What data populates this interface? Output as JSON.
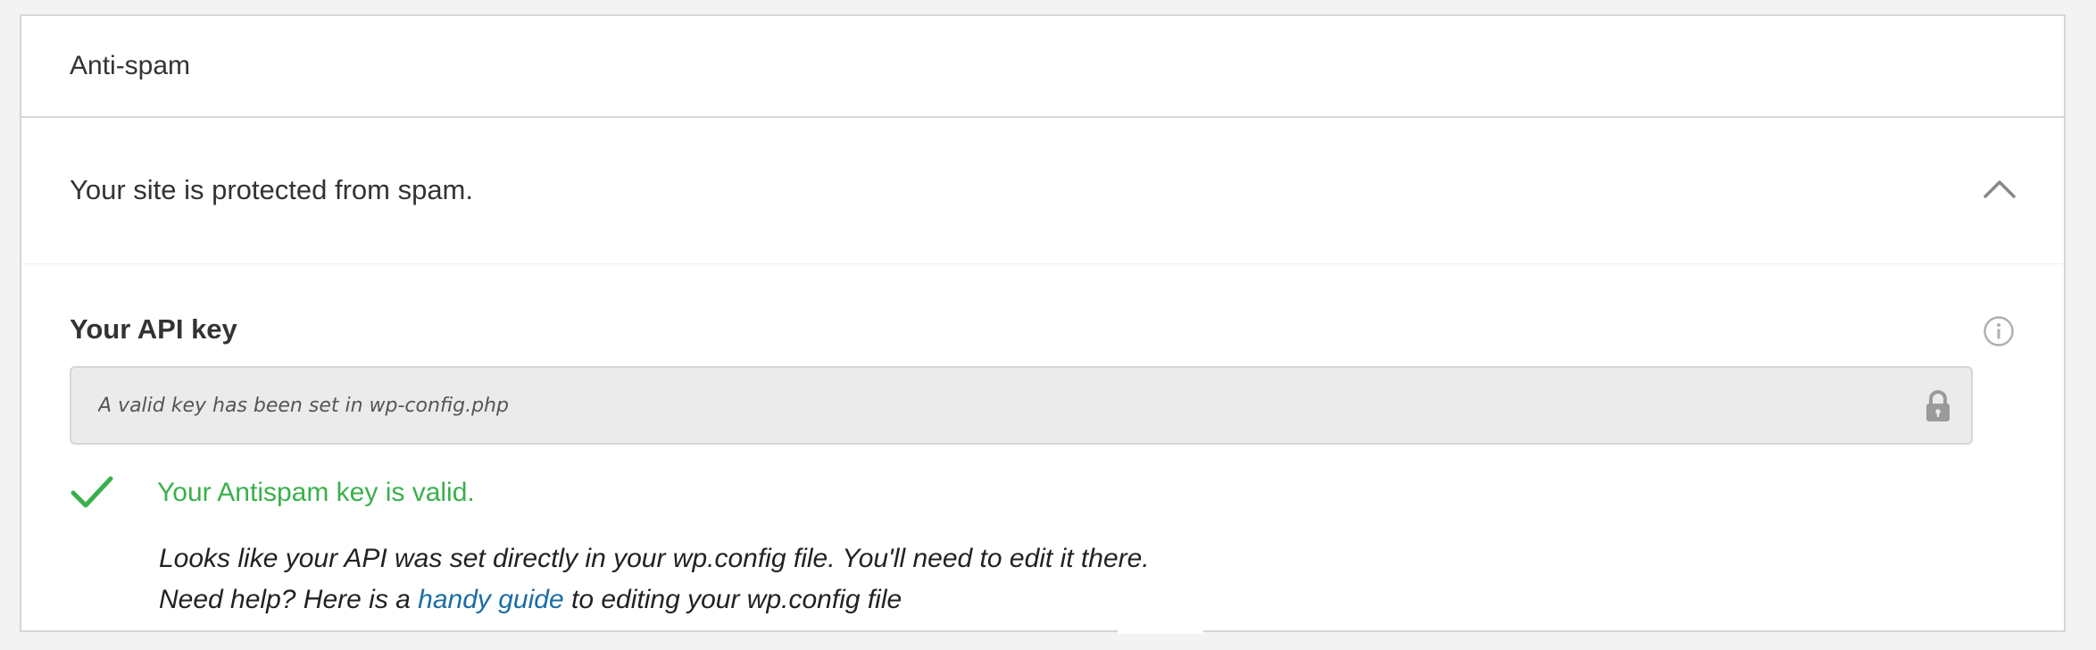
{
  "card": {
    "title": "Anti-spam"
  },
  "status": {
    "message": "Your site is protected from spam.",
    "toggle_icon": "chevron-up-icon"
  },
  "api_key": {
    "label": "Your API key",
    "info_icon": "info-icon",
    "placeholder": "A valid key has been set in wp-config.php",
    "value": "",
    "lock_icon": "lock-icon"
  },
  "validation": {
    "icon": "checkmark-icon",
    "message": "Your Antispam key is valid.",
    "color": "#3ab04c"
  },
  "help": {
    "line1": "Looks like your API was set directly in your wp.config file. You'll need to edit it there.",
    "line2_prefix": "Need help? Here is a ",
    "link_text": "handy guide",
    "line2_suffix": " to editing your wp.config file",
    "link_color": "#1a6da5"
  }
}
